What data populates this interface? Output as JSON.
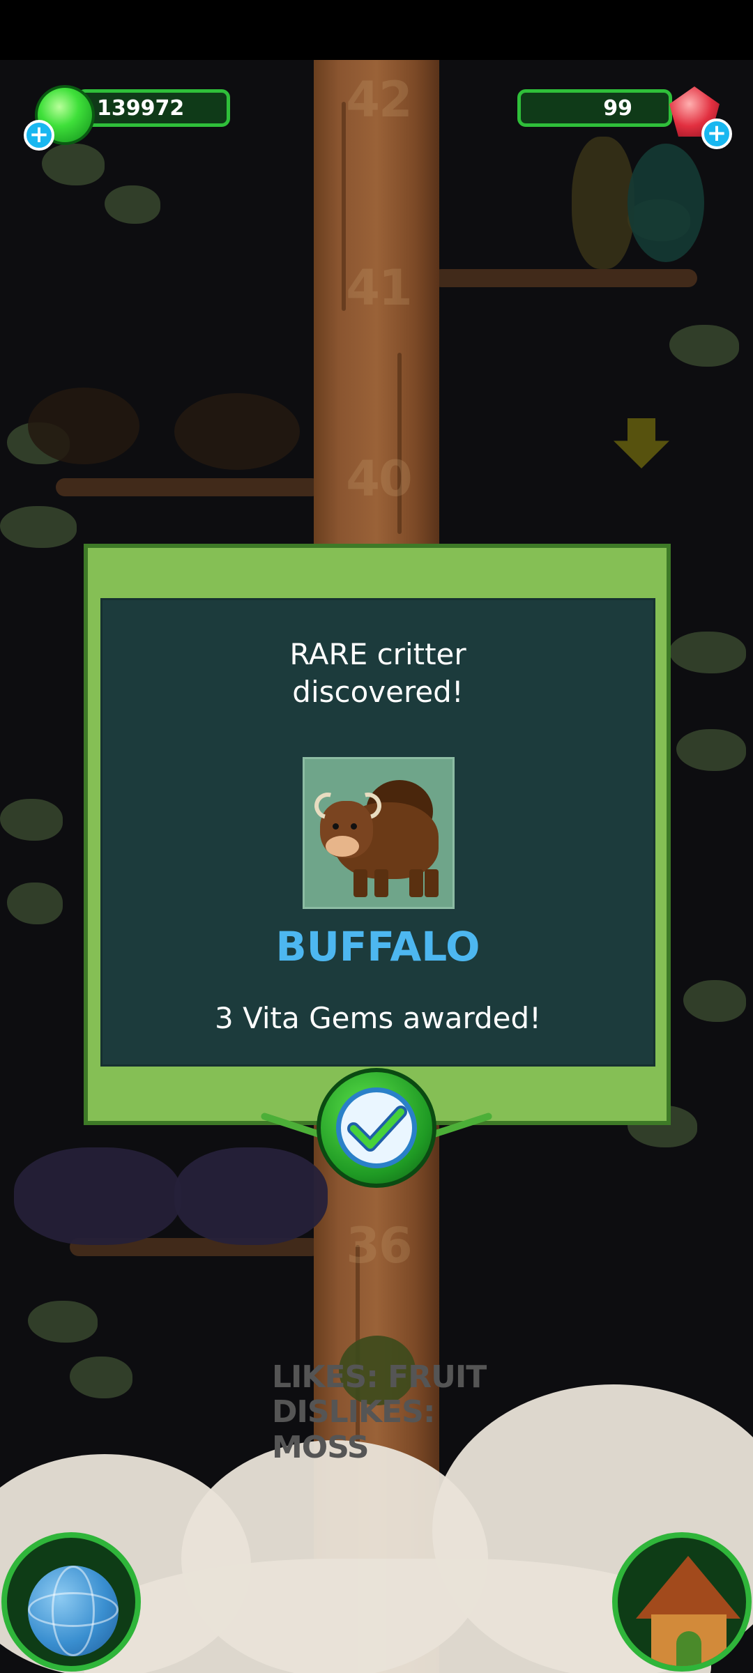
{
  "hud": {
    "green_currency": "139972",
    "gems": "99"
  },
  "popup": {
    "heading": "RARE critter discovered!",
    "critter_name": "BUFFALO",
    "award": "3 Vita Gems awarded!"
  },
  "tree": {
    "markers": [
      "42",
      "41",
      "40",
      "36"
    ]
  },
  "critter_info": {
    "likes": "LIKES: FRUIT",
    "dislikes": "DISLIKES: MOSS"
  },
  "icons": {
    "hud_left_plus": "plus-icon",
    "hud_right_plus": "plus-icon",
    "confirm": "checkmark-icon",
    "scroll": "arrow-down-icon",
    "map": "globe-icon",
    "home": "house-icon"
  },
  "colors": {
    "popup_frame": "#85bf55",
    "popup_panel": "#1c3b3c",
    "critter_name": "#4db7f0",
    "hud_border": "#2fbf3a"
  }
}
